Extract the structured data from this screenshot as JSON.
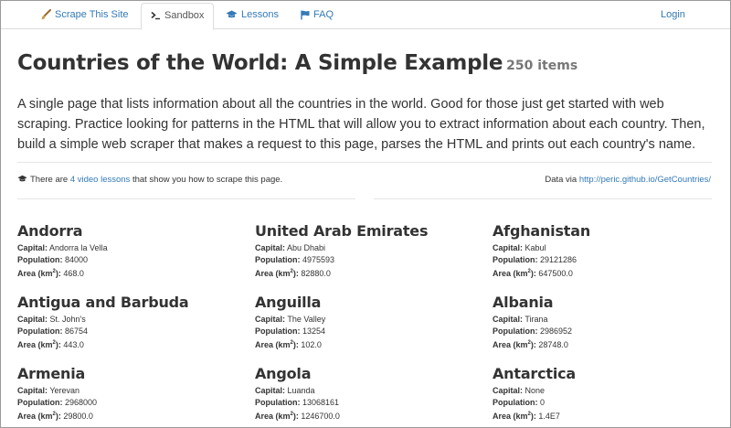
{
  "nav": {
    "items": [
      {
        "label": "Scrape This Site",
        "icon": "paintbrush-icon"
      },
      {
        "label": "Sandbox",
        "icon": "terminal-icon"
      },
      {
        "label": "Lessons",
        "icon": "graduation-cap-icon"
      },
      {
        "label": "FAQ",
        "icon": "flag-icon"
      }
    ],
    "login": "Login",
    "active": "Sandbox"
  },
  "page": {
    "title": "Countries of the World: A Simple Example",
    "count": "250 items",
    "intro": "A single page that lists information about all the countries in the world. Good for those just get started with web scraping. Practice looking for patterns in the HTML that will allow you to extract information about each country. Then, build a simple web scraper that makes a request to this page, parses the HTML and prints out each country's name."
  },
  "lessons_note": {
    "prefix": "There are ",
    "link": "4 video lessons",
    "suffix": " that show you how to scrape this page."
  },
  "data_via": {
    "prefix": "Data via ",
    "link": "http://peric.github.io/GetCountries/"
  },
  "labels": {
    "capital": "Capital:",
    "population": "Population:",
    "area_prefix": "Area (km",
    "area_sup": "2",
    "area_suffix": "):"
  },
  "countries": [
    {
      "name": "Andorra",
      "capital": "Andorra la Vella",
      "population": "84000",
      "area": "468.0"
    },
    {
      "name": "United Arab Emirates",
      "capital": "Abu Dhabi",
      "population": "4975593",
      "area": "82880.0"
    },
    {
      "name": "Afghanistan",
      "capital": "Kabul",
      "population": "29121286",
      "area": "647500.0"
    },
    {
      "name": "Antigua and Barbuda",
      "capital": "St. John's",
      "population": "86754",
      "area": "443.0"
    },
    {
      "name": "Anguilla",
      "capital": "The Valley",
      "population": "13254",
      "area": "102.0"
    },
    {
      "name": "Albania",
      "capital": "Tirana",
      "population": "2986952",
      "area": "28748.0"
    },
    {
      "name": "Armenia",
      "capital": "Yerevan",
      "population": "2968000",
      "area": "29800.0"
    },
    {
      "name": "Angola",
      "capital": "Luanda",
      "population": "13068161",
      "area": "1246700.0"
    },
    {
      "name": "Antarctica",
      "capital": "None",
      "population": "0",
      "area": "1.4E7"
    }
  ],
  "colors": {
    "link": "#337ab7",
    "text": "#333333",
    "muted": "#777777",
    "border": "#dddddd"
  }
}
